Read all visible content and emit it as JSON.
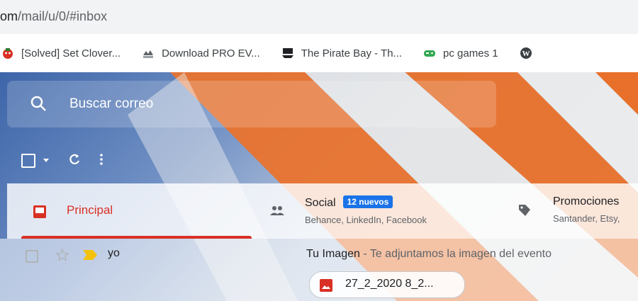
{
  "browser": {
    "url_host": "om",
    "url_path": "/mail/u/0/#inbox"
  },
  "bookmarks": [
    {
      "label": "[Solved] Set Clover...",
      "icon": "clover-icon"
    },
    {
      "label": "Download PRO EV...",
      "icon": "download-site-icon"
    },
    {
      "label": "The Pirate Bay - Th...",
      "icon": "pirate-ship-icon"
    },
    {
      "label": "pc games 1",
      "icon": "gamepad-icon"
    },
    {
      "label": "",
      "icon": "wordpress-icon"
    }
  ],
  "search": {
    "placeholder": "Buscar correo"
  },
  "tabs": {
    "principal": {
      "label": "Principal"
    },
    "social": {
      "label": "Social",
      "badge": "12 nuevos",
      "sub": "Behance, LinkedIn, Facebook"
    },
    "promos": {
      "label": "Promociones",
      "sub": "Santander, Etsy,"
    }
  },
  "email": {
    "sender": "yo",
    "subject": "Tu Imagen",
    "snippet": "Te adjuntamos la imagen del evento",
    "attachment": "27_2_2020 8_2..."
  },
  "colors": {
    "accent_red": "#d93025",
    "badge_blue": "#1a73e8"
  }
}
